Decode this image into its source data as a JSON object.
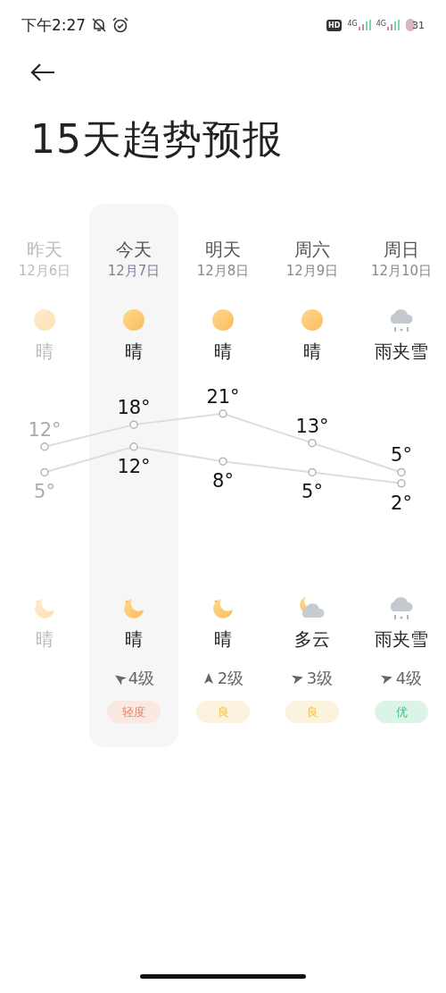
{
  "status_bar": {
    "time": "下午2:27",
    "hd": "HD",
    "networks": [
      "4G",
      "4G"
    ],
    "battery": "31"
  },
  "title": "15天趋势预报",
  "days": [
    {
      "label": "昨天",
      "date": "12月6日",
      "past": true,
      "selected": false,
      "day": {
        "kind": "sun",
        "condition": "晴"
      },
      "high": "12°",
      "low": "5°",
      "night": {
        "kind": "moon",
        "condition": "晴"
      }
    },
    {
      "label": "今天",
      "date": "12月7日",
      "past": false,
      "selected": true,
      "day": {
        "kind": "sun",
        "condition": "晴"
      },
      "high": "18°",
      "low": "12°",
      "night": {
        "kind": "moon",
        "condition": "晴"
      },
      "wind": {
        "kind": "northwest",
        "text": "4级"
      },
      "aqi": {
        "text": "轻度",
        "color": "#e8825a"
      }
    },
    {
      "label": "明天",
      "date": "12月8日",
      "past": false,
      "selected": false,
      "day": {
        "kind": "sun",
        "condition": "晴"
      },
      "high": "21°",
      "low": "8°",
      "night": {
        "kind": "moon",
        "condition": "晴"
      },
      "wind": {
        "kind": "north",
        "text": "2级"
      },
      "aqi": {
        "text": "良",
        "color": "#f0bd4a"
      }
    },
    {
      "label": "周六",
      "date": "12月9日",
      "past": false,
      "selected": false,
      "day": {
        "kind": "sun",
        "condition": "晴"
      },
      "high": "13°",
      "low": "5°",
      "night": {
        "kind": "cloudy_night",
        "condition": "多云"
      },
      "wind": {
        "kind": "east",
        "text": "3级"
      },
      "aqi": {
        "text": "良",
        "color": "#f0bd4a"
      }
    },
    {
      "label": "周日",
      "date": "12月10日",
      "past": false,
      "selected": false,
      "day": {
        "kind": "sleet",
        "condition": "雨夹雪"
      },
      "high": "5°",
      "low": "2°",
      "night": {
        "kind": "sleet",
        "condition": "雨夹雪"
      },
      "wind": {
        "kind": "east",
        "text": "4级"
      },
      "aqi": {
        "text": "优",
        "color": "#3cbf7c"
      }
    }
  ]
}
